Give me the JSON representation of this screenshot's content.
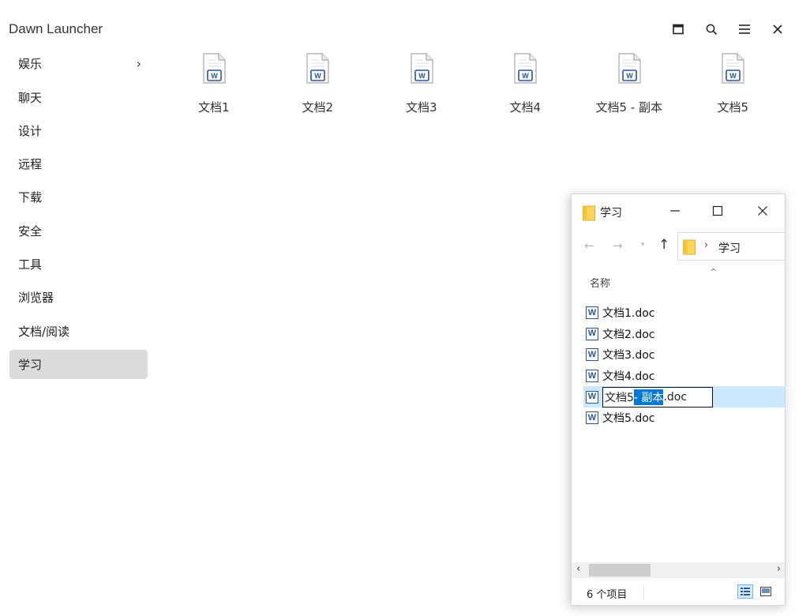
{
  "app": {
    "title": "Dawn Launcher"
  },
  "colors": {
    "sidebar_active": "#dcdcdc",
    "selection": "#cce8ff",
    "highlight": "#0078d7",
    "word_blue": "#2b579a",
    "folder": "#ffd65c"
  },
  "sidebar": {
    "items": [
      {
        "label": "娱乐"
      },
      {
        "label": "聊天"
      },
      {
        "label": "设计"
      },
      {
        "label": "远程"
      },
      {
        "label": "下载"
      },
      {
        "label": "安全"
      },
      {
        "label": "工具"
      },
      {
        "label": "浏览器"
      },
      {
        "label": "文档/阅读"
      },
      {
        "label": "学习"
      }
    ],
    "active_index": 9,
    "expand_index": 0
  },
  "grid": {
    "items": [
      {
        "label": "文档1"
      },
      {
        "label": "文档2"
      },
      {
        "label": "文档3"
      },
      {
        "label": "文档4"
      },
      {
        "label": "文档5 - 副本"
      },
      {
        "label": "文档5"
      }
    ]
  },
  "explorer": {
    "title": "学习",
    "address": "学习",
    "column_name": "名称",
    "files": [
      {
        "name": "文档1.doc"
      },
      {
        "name": "文档2.doc"
      },
      {
        "name": "文档3.doc"
      },
      {
        "name": "文档4.doc"
      },
      {
        "name": "文档5.doc"
      }
    ],
    "rename": {
      "before": "文档5",
      "selected": " - 副本",
      "after": ".doc"
    },
    "status": "6 个项目"
  }
}
